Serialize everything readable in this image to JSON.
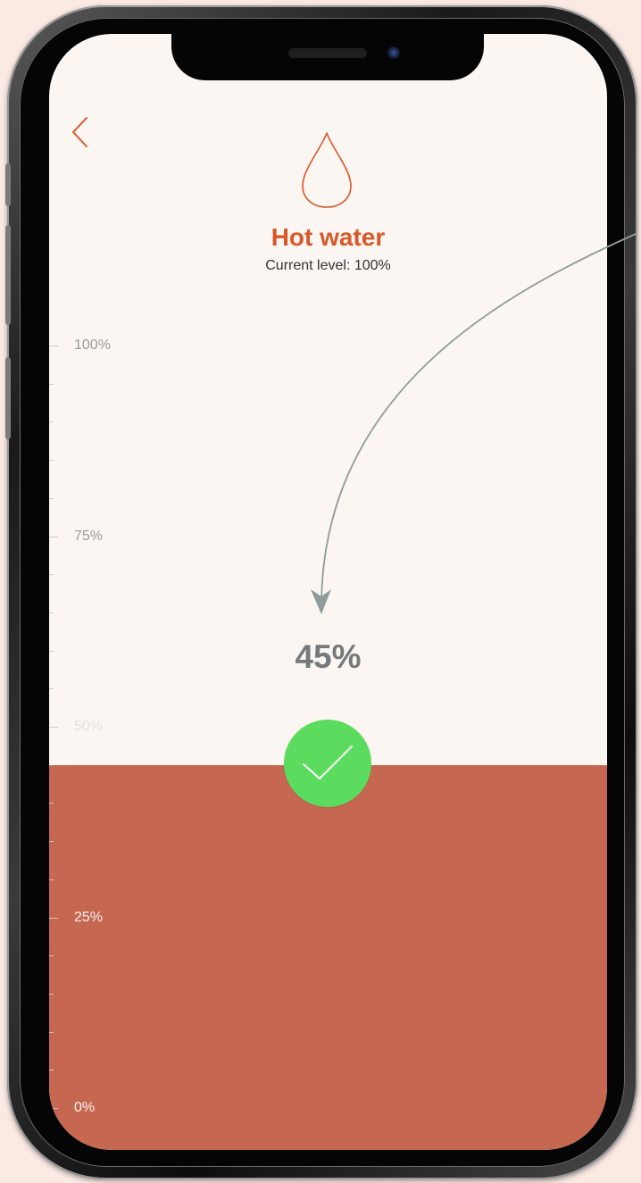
{
  "header": {
    "title": "Hot water",
    "subtitle": "Current level: 100%",
    "back_icon": "chevron-left-icon",
    "drop_icon": "water-drop-icon"
  },
  "level": {
    "current_value_label": "45%",
    "selected_fraction": 0.45,
    "confirm_icon": "checkmark-icon"
  },
  "scale": {
    "labels": [
      "100%",
      "75%",
      "50%",
      "25%",
      "0%"
    ]
  },
  "colors": {
    "accent": "#d8582a",
    "fill": "#c66751",
    "confirm": "#5bdc5e",
    "background": "#fbf6f2",
    "arrow": "#8f9c9b"
  }
}
